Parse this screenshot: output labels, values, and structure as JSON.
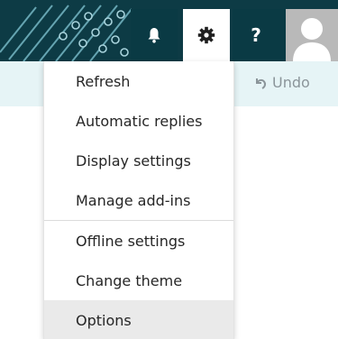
{
  "header": {
    "buttons": [
      {
        "name": "notifications",
        "icon": "bell-icon"
      },
      {
        "name": "settings",
        "icon": "gear-icon",
        "active": true
      },
      {
        "name": "help",
        "icon": "question-icon",
        "label": "?"
      },
      {
        "name": "account",
        "icon": "avatar-icon"
      }
    ],
    "help_label": "?"
  },
  "command_bar": {
    "undo_label": "Undo",
    "undo_icon": "undo-icon"
  },
  "settings_menu": {
    "items": [
      {
        "label": "Refresh"
      },
      {
        "label": "Automatic replies"
      },
      {
        "label": "Display settings"
      },
      {
        "label": "Manage add-ins"
      },
      {
        "label": "Offline settings"
      },
      {
        "label": "Change theme"
      },
      {
        "label": "Options",
        "highlighted": true
      }
    ]
  },
  "colors": {
    "header_bg": "#0d3b45",
    "command_bar_bg": "#e6f4f6",
    "menu_hover": "#eaeaea",
    "muted_text": "#8b959a"
  }
}
